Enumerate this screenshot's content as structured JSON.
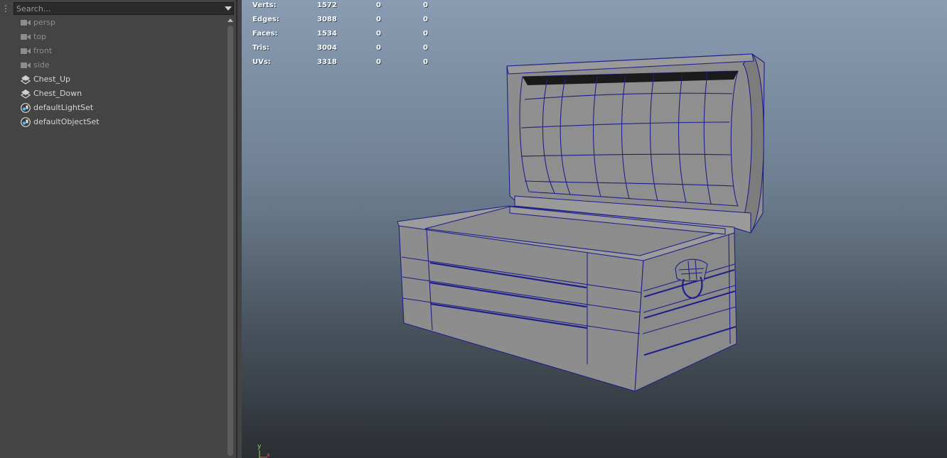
{
  "outliner": {
    "search_placeholder": "Search...",
    "items": [
      {
        "label": "persp",
        "icon": "camera-icon",
        "type": "camera"
      },
      {
        "label": "top",
        "icon": "camera-icon",
        "type": "camera"
      },
      {
        "label": "front",
        "icon": "camera-icon",
        "type": "camera"
      },
      {
        "label": "side",
        "icon": "camera-icon",
        "type": "camera"
      },
      {
        "label": "Chest_Up",
        "icon": "transform-icon",
        "type": "geometry"
      },
      {
        "label": "Chest_Down",
        "icon": "transform-icon",
        "type": "geometry"
      },
      {
        "label": "defaultLightSet",
        "icon": "set-icon",
        "type": "set"
      },
      {
        "label": "defaultObjectSet",
        "icon": "set-icon",
        "type": "set"
      }
    ]
  },
  "viewport": {
    "hud": [
      {
        "label": "Verts:",
        "v1": "1572",
        "v2": "0",
        "v3": "0"
      },
      {
        "label": "Edges:",
        "v1": "3088",
        "v2": "0",
        "v3": "0"
      },
      {
        "label": "Faces:",
        "v1": "1534",
        "v2": "0",
        "v3": "0"
      },
      {
        "label": "Tris:",
        "v1": "3004",
        "v2": "0",
        "v3": "0"
      },
      {
        "label": "UVs:",
        "v1": "3318",
        "v2": "0",
        "v3": "0"
      }
    ],
    "axis": {
      "y": "y",
      "x": "x"
    },
    "wire_color": "#1f1f8a",
    "gradient_top": "#8a9cb2",
    "gradient_bottom": "#2b2e32"
  }
}
